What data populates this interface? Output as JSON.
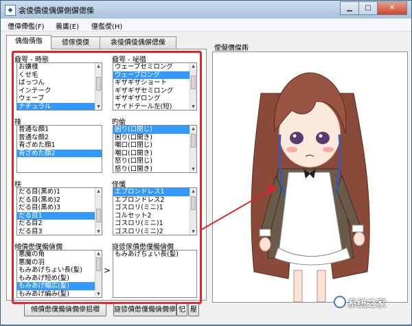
{
  "window": {
    "title": "衾倰僨倰偊偋側偋偲偨"
  },
  "menu": [
    {
      "label": "僼傽僀儖(F)"
    },
    {
      "label": "曇廤(E)"
    },
    {
      "label": "僿儖僾(H)"
    }
  ],
  "tabs": [
    {
      "label": "偊偺偦偺"
    },
    {
      "label": "偐傢偄偄"
    },
    {
      "label": "衾倰僨倰偊偋偲偨"
    }
  ],
  "groups": [
    {
      "label": "鼗咢 - 時態",
      "items": [
        "お嫌様",
        "くせ毛",
        "ぱっつん",
        "インテーク",
        "ウェーブ",
        "ナチュラル"
      ],
      "selected": 5
    },
    {
      "label": "鼗咢 - 咇徣",
      "items": [
        "ウェーブセミロング",
        "ウェーブロング",
        "ギザギザショート",
        "ギザギザセミロング",
        "ギザギザロング",
        "サイドテール左(短)"
      ],
      "selected": 1
    },
    {
      "label": "捀",
      "items": [
        "普通な顔1",
        "普通な顔2",
        "青ざめた顔1",
        "青ざめた顔2"
      ],
      "selected": 3
    },
    {
      "label": "旳偸",
      "items": [
        "困り(口閉じ)",
        "困り(口開き)",
        "嘲口(口閉じ)",
        "嘲口(口開き)",
        "怒り(口閉じ)",
        "怒り(口開き)"
      ],
      "selected": 0
    },
    {
      "label": "栚",
      "items": [
        "だる目(黒め)1",
        "だる目(黒め)2",
        "だる目(黒め)3",
        "だる目1",
        "だる目2",
        "だる目3"
      ],
      "selected": 3
    },
    {
      "label": "怪懺",
      "items": [
        "エプロンドレス1",
        "エプロンドレス2",
        "ゴスロリ(ミニ)1",
        "コルセット2",
        "ゴスロリ(ミニ)1",
        "ゴスロリ(ミニ)2"
      ],
      "selected": 0
    },
    {
      "label": "傾僨僽僕僃僋僩",
      "items": [
        "悪魔の角",
        "悪魔の羽",
        "もみあげちょい長(髪)",
        "もみあげ短め(髪)",
        "もみあげ幅広(髪)",
        "もみあげ編み(髪)"
      ],
      "selected": 4
    },
    {
      "label": "旞偐傢僨僽僕僃僋僩",
      "items": [
        "もみあげちょい長(髪)"
      ],
      "selected": -1
    }
  ],
  "move_button": {
    "label": ">"
  },
  "buttons": {
    "left": "傾僨僽僕僃僋僩傪捛壛",
    "right": "旞偐僨僽僕僃僋僩傪嶍",
    "small1": "忋",
    "small2": "壓"
  },
  "preview": {
    "label": "僾儗價儏乕"
  },
  "watermark": {
    "text": "系统之家"
  },
  "colors": {
    "selection": "#3399ff",
    "highlight_border": "#e0242a",
    "arrow": "#e0242a"
  }
}
